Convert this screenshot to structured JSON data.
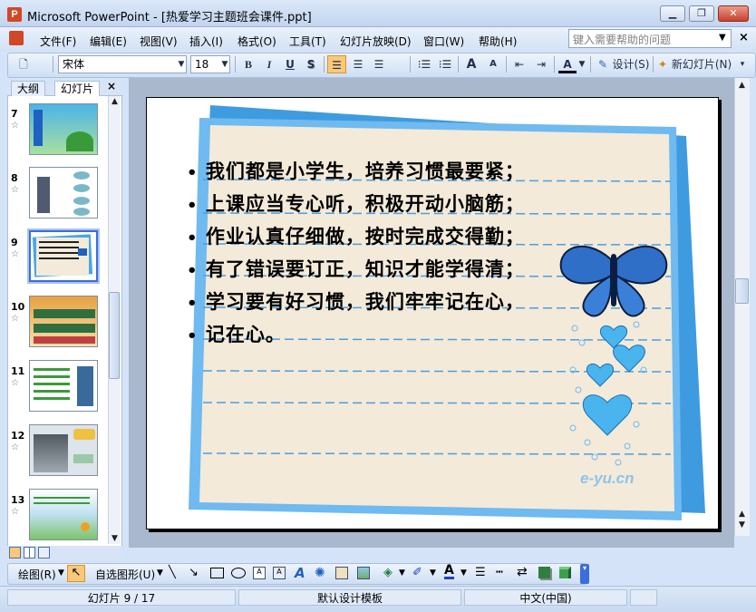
{
  "window": {
    "title": "Microsoft PowerPoint - [热爱学习主题班会课件.ppt]",
    "app_icon": "P",
    "minimize_label": "▁",
    "restore_label": "❐",
    "close_label": "✕"
  },
  "menu": {
    "items": [
      "文件(F)",
      "编辑(E)",
      "视图(V)",
      "插入(I)",
      "格式(O)",
      "工具(T)",
      "幻灯片放映(D)",
      "窗口(W)",
      "帮助(H)"
    ],
    "help_placeholder": "键入需要帮助的问题",
    "close": "×"
  },
  "toolbar": {
    "font_name": "宋体",
    "font_size": "18",
    "bold": "B",
    "italic": "I",
    "underline": "U",
    "shadow": "S",
    "design_label": "设计(S)",
    "new_slide_label": "新幻灯片(N)",
    "grow_font": "A",
    "shrink_font": "A",
    "font_color": "A"
  },
  "left_pane": {
    "tab_outline": "大纲",
    "tab_slides": "幻灯片",
    "close": "×",
    "slides": [
      {
        "num": "7"
      },
      {
        "num": "8"
      },
      {
        "num": "9"
      },
      {
        "num": "10"
      },
      {
        "num": "11"
      },
      {
        "num": "12"
      },
      {
        "num": "13"
      }
    ],
    "star": "☆"
  },
  "slide": {
    "bullets": [
      "我们都是小学生，培养习惯最要紧；",
      "上课应当专心听，积极开动小脑筋；",
      "作业认真仔细做，按时完成交得勤；",
      "有了错误要订正，知识才能学得清；",
      "学习要有好习惯，我们牢牢记在心，",
      "记在心。"
    ],
    "watermark": "e-yu.cn",
    "colors": {
      "paper": "#f4ead9",
      "frame": "#5aaee8",
      "back_card": "#3f9be0"
    }
  },
  "draw_toolbar": {
    "draw_label": "绘图(R)",
    "autoshapes_label": "自选图形(U)"
  },
  "status": {
    "slide_info": "幻灯片 9 / 17",
    "template": "默认设计模板",
    "language": "中文(中国)"
  }
}
